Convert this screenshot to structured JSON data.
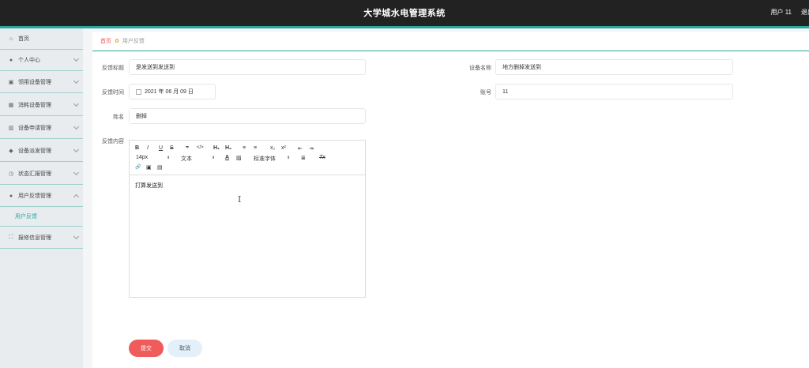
{
  "header": {
    "title": "大学城水电管理系统",
    "user": "用户 11",
    "logout": "退出"
  },
  "sidebar": {
    "items": [
      {
        "label": "首页",
        "icon": "home-icon",
        "glyph": "⌂"
      },
      {
        "label": "个人中心",
        "icon": "user-icon",
        "glyph": "●"
      },
      {
        "label": "领用设备管理",
        "icon": "printer-icon",
        "glyph": "▣"
      },
      {
        "label": "消耗设备管理",
        "icon": "grid-icon",
        "glyph": "▦"
      },
      {
        "label": "设备申请管理",
        "icon": "chart-icon",
        "glyph": "▥"
      },
      {
        "label": "设备派发管理",
        "icon": "shield-icon",
        "glyph": "◆"
      },
      {
        "label": "状态汇报管理",
        "icon": "clock-icon",
        "glyph": "◷"
      },
      {
        "label": "用户反馈管理",
        "icon": "user-icon",
        "glyph": "●"
      },
      {
        "label": "报修信息管理",
        "icon": "expand-icon",
        "glyph": "⛶"
      }
    ],
    "sub_item": "用户反馈"
  },
  "breadcrumb": {
    "home": "首页",
    "current": "用户反馈"
  },
  "form": {
    "title_label": "反馈标题",
    "title_value": "是发送到发送到",
    "device_label": "设备名称",
    "device_value": "地方删掉发送到",
    "time_label": "反馈时间",
    "time_value": "2021 年 06 月 09 日",
    "account_label": "账号",
    "account_value": "11",
    "name_label": "姓名",
    "name_value": "删掉",
    "content_label": "反馈内容",
    "content_value": "打算发送到"
  },
  "editor": {
    "size": "14px",
    "text_style": "文本",
    "font": "标准字体",
    "tools": [
      "B",
      "I",
      "U",
      "S",
      "❞",
      "</>",
      "H₁",
      "H₂",
      "≡",
      "≡",
      "x₂",
      "x²",
      "⇤",
      "⇥",
      "A",
      "▨",
      "≣",
      "Tx",
      "🔗",
      "▣",
      "▤"
    ]
  },
  "buttons": {
    "submit": "提交",
    "cancel": "取消"
  },
  "colors": {
    "accent": "#2aa79b",
    "submit": "#f05b5b",
    "header": "#222222"
  }
}
